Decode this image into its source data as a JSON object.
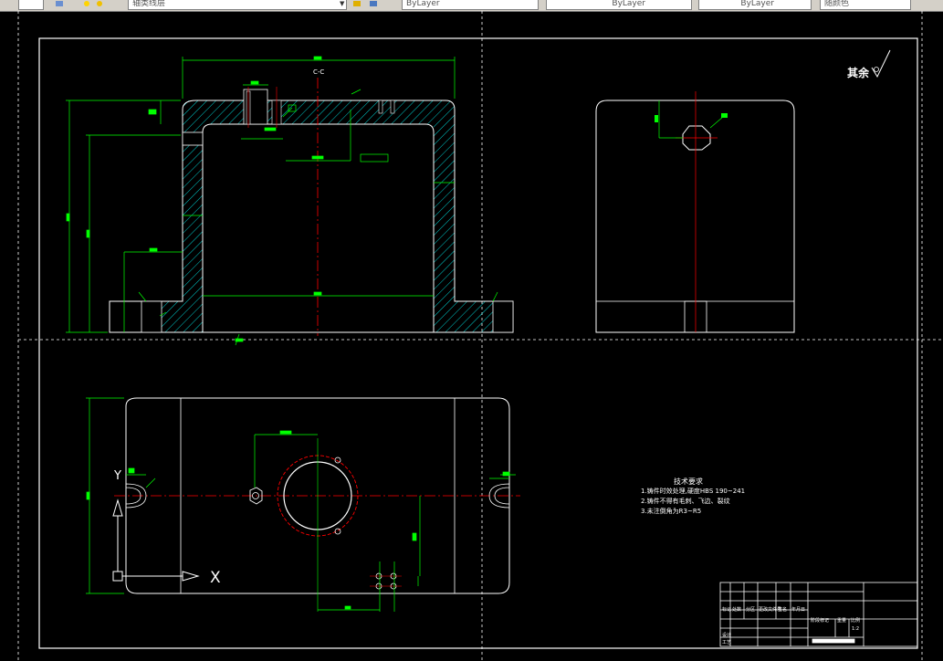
{
  "toolbar": {
    "layer_name": "轴类线层",
    "color_value": "ByLayer",
    "linetype_value": "ByLayer",
    "lineweight_value": "ByLayer",
    "plotstyle_value": "随颜色"
  },
  "drawing": {
    "section_label": "C-C",
    "roughness_note": "其余",
    "axis_y_label": "Y",
    "axis_x_label": "X",
    "technical_requirements": {
      "title": "技术要求",
      "items": [
        "1.铸件时效处理,硬度HBS 190~241",
        "2.铸件不得有毛刺、飞边、裂纹",
        "3.未注倒角为R3~R5"
      ]
    },
    "title_block": {
      "row_labels": [
        "标记",
        "处数",
        "分区",
        "更改文件号",
        "签名",
        "年月日"
      ],
      "designer_label": "设计",
      "process_label": "工艺",
      "stage_label": "阶段标记",
      "weight_label": "重量",
      "scale_label": "比例",
      "scale_value": "1:2"
    }
  },
  "colors": {
    "background": "#000000",
    "outline": "#ffffff",
    "dimension": "#00ff00",
    "centerline": "#ff0000",
    "hatch": "#00ffff"
  }
}
